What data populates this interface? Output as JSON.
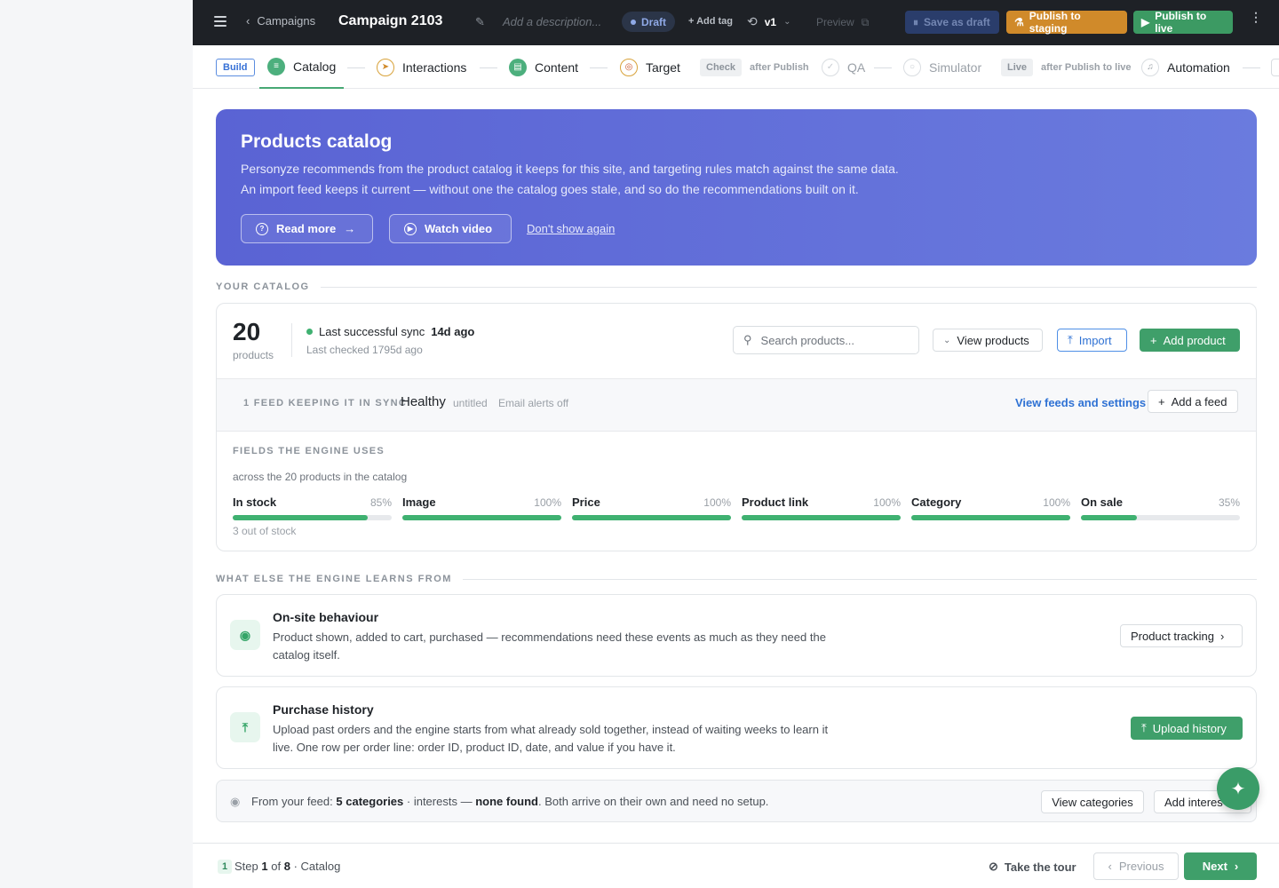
{
  "topbar": {
    "back_label": "Campaigns",
    "title": "Campaign 2103",
    "description_placeholder": "Add a description...",
    "status": "Draft",
    "add_tag": "+ Add tag",
    "version": "v1",
    "preview": "Preview",
    "save_draft": "Save as draft",
    "publish_staging": "Publish to staging",
    "publish_live": "Publish to live"
  },
  "steps": {
    "build_badge": "Build",
    "catalog": "Catalog",
    "interactions": "Interactions",
    "content": "Content",
    "target": "Target",
    "check_badge": "Check",
    "check_after": "after Publish",
    "qa": "QA",
    "simulator": "Simulator",
    "live_badge": "Live",
    "live_after": "after Publish to live",
    "automation": "Automation"
  },
  "hero": {
    "title": "Products catalog",
    "line1": "Personyze recommends from the product catalog it keeps for this site, and targeting rules match against the same data.",
    "line2": "An import feed keeps it current — without one the catalog goes stale, and so do the recommendations built on it.",
    "read_more": "Read more",
    "watch_video": "Watch video",
    "dont_show": "Don't show again"
  },
  "your_catalog": {
    "section_title": "YOUR CATALOG",
    "count": "20",
    "count_label": "products",
    "sync_label": "Last successful sync",
    "sync_value": "14d ago",
    "last_checked": "Last checked 1795d ago",
    "search_placeholder": "Search products...",
    "view_products": "View products",
    "import": "Import",
    "add_product": "Add product",
    "feed_label": "1 FEED KEEPING IT IN SYNC",
    "feed_health": "Healthy",
    "feed_name": "untitled",
    "feed_alerts": "Email alerts off",
    "view_feeds": "View feeds and settings",
    "add_feed": "Add a feed",
    "fields_title": "FIELDS THE ENGINE USES",
    "fields_subtitle": "across the 20 products in the catalog",
    "fields": [
      {
        "name": "In stock",
        "percent": "85%",
        "value": 0.85
      },
      {
        "name": "Image",
        "percent": "100%",
        "value": 1.0
      },
      {
        "name": "Price",
        "percent": "100%",
        "value": 1.0
      },
      {
        "name": "Product link",
        "percent": "100%",
        "value": 1.0
      },
      {
        "name": "Category",
        "percent": "100%",
        "value": 1.0
      },
      {
        "name": "On sale",
        "percent": "35%",
        "value": 0.35
      }
    ],
    "out_of_stock_note": "3 out of stock"
  },
  "learns": {
    "section_title": "WHAT ELSE THE ENGINE LEARNS FROM",
    "onsite_title": "On-site behaviour",
    "onsite_desc": "Product shown, added to cart, purchased — recommendations need these events as much as they need the catalog itself.",
    "onsite_button": "Product tracking",
    "purchase_title": "Purchase history",
    "purchase_desc": "Upload past orders and the engine starts from what already sold together, instead of waiting weeks to learn it live. One row per order line: order ID, product ID, date, and value if you have it.",
    "purchase_button": "Upload history",
    "feed_prefix": "From your feed:",
    "feed_categories": "5 categories",
    "feed_mid": "· interests —",
    "feed_none": "none found",
    "feed_suffix": ". Both arrive on their own and need no setup.",
    "view_categories": "View categories",
    "add_interests": "Add interes"
  },
  "footer": {
    "step_no": "1",
    "step_word": "Step",
    "step_current": "1",
    "step_of": "of",
    "step_total": "8",
    "step_name": "· Catalog",
    "tour": "Take the tour",
    "previous": "Previous",
    "next": "Next"
  },
  "colors": {
    "accent": "#3f9f6a",
    "hero_start": "#5a63d4",
    "hero_end": "#6a7bde",
    "topbar": "#1e2126"
  }
}
